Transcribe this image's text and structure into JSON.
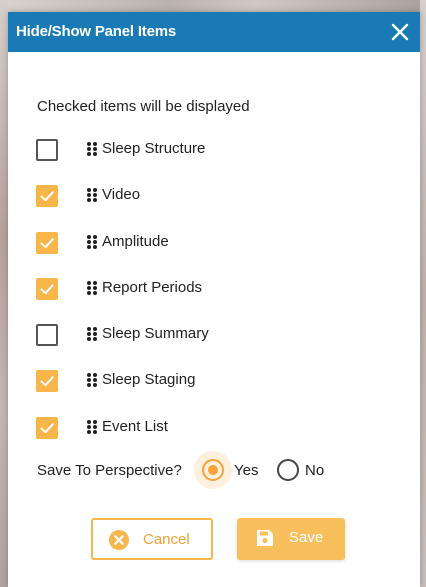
{
  "dialog": {
    "title": "Hide/Show Panel Items",
    "close_icon": "close-icon",
    "instructions": "Checked items will be displayed"
  },
  "items": [
    {
      "label": "Sleep Structure",
      "checked": false
    },
    {
      "label": "Video",
      "checked": true
    },
    {
      "label": "Amplitude",
      "checked": true
    },
    {
      "label": "Report Periods",
      "checked": true
    },
    {
      "label": "Sleep Summary",
      "checked": false
    },
    {
      "label": "Sleep Staging",
      "checked": true
    },
    {
      "label": "Event List",
      "checked": true
    }
  ],
  "perspective": {
    "label": "Save To Perspective?",
    "options": [
      "Yes",
      "No"
    ],
    "selected": "Yes"
  },
  "buttons": {
    "cancel_label": "Cancel",
    "cancel_icon": "cancel-circle-icon",
    "save_label": "Save",
    "save_icon": "floppy-disk-icon"
  },
  "colors": {
    "header": "#1a7ab6",
    "accent": "#f7b54a",
    "text": "#222222"
  }
}
